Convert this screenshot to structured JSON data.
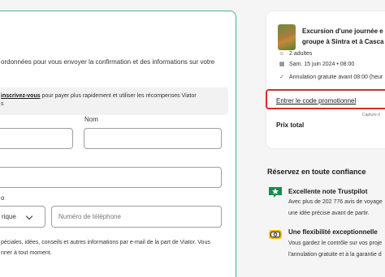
{
  "form": {
    "intro_line1": "ordonnées pour vous envoyer la confirmation et des informations sur votre",
    "intro_line2": "",
    "signin_link": "inscrivez-vous",
    "signin_text": " pour payer plus rapidement et utiliser les récompenses Viator",
    "signin_text2": "s",
    "nom_label": "Nom",
    "phone_label_fragment": "o",
    "country_value": "rique",
    "phone_placeholder": "Numéro de téléphone",
    "optin_line1": "péciales, idées, conseils et autres informations par e-mail de la part de Viator. Vous",
    "optin_line2": "nner à tout moment."
  },
  "summary": {
    "tour_title_line1": "Excursion d'une journée e",
    "tour_title_line2": "groupe à Sintra et à Casca",
    "travelers": "2 adultes",
    "date": "Sam. 15 juin 2024 • 08:00",
    "cancellation": "Annulation gratuite avant 08:00 (heur",
    "promo_link": "Entrer le code promotionnel",
    "captured_label": "Capture d",
    "total_label": "Prix total"
  },
  "confidence": {
    "heading": "Réservez en toute confiance",
    "features": [
      {
        "icon": "trustpilot-star-icon",
        "title": "Excellente note Trustpilot",
        "line1": "Avec plus de 202 776 avis de voyage",
        "line2": "une idée précise avant de partir."
      },
      {
        "icon": "calendar-flexibility-icon",
        "title": "Une flexibilité exceptionnelle",
        "line1": "Vous gardez le contrôle sur vos proje",
        "line2": "l'annulation gratuite et à la garantie d"
      }
    ]
  },
  "colors": {
    "accent_green": "#4caf8e",
    "highlight_red": "#d32f2f",
    "brand_green": "#1a8a4c"
  }
}
